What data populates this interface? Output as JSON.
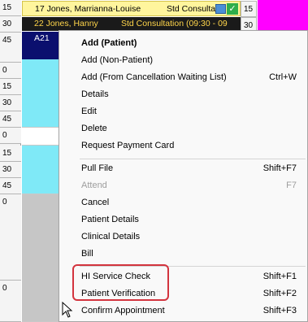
{
  "book": {
    "times_left": [
      "15",
      "30",
      "45",
      "0",
      "15",
      "30",
      "45",
      "0",
      "15",
      "30",
      "45",
      "0",
      "0"
    ],
    "time_right_1": "15",
    "time_right_2": "30",
    "appointment_1": {
      "patient": "17 Jones, Marrianna-Louise",
      "type": "Std Consulta"
    },
    "appointment_2": {
      "patient": "22 Jones, Hanny",
      "type": "Std Consultation (09:30 - 09"
    },
    "appointment_3": {
      "code": "A21"
    },
    "colors": {
      "slot_cyan": "#7fe9f7",
      "slot_grey": "#c6c6c6",
      "yellow": "#fff59d",
      "dark_blue": "#0b0f6e",
      "pink": "#ff00ff",
      "highlight_red": "#d3343e"
    }
  },
  "menu": {
    "items": [
      {
        "label": "Add (Patient)",
        "shortcut": ""
      },
      {
        "label": "Add (Non-Patient)",
        "shortcut": ""
      },
      {
        "label": "Add (From Cancellation Waiting List)",
        "shortcut": "Ctrl+W"
      },
      {
        "label": "Details",
        "shortcut": ""
      },
      {
        "label": "Edit",
        "shortcut": ""
      },
      {
        "label": "Delete",
        "shortcut": ""
      },
      {
        "label": "Request Payment Card",
        "shortcut": ""
      },
      {
        "label": "Pull File",
        "shortcut": "Shift+F7"
      },
      {
        "label": "Attend",
        "shortcut": "F7"
      },
      {
        "label": "Cancel",
        "shortcut": ""
      },
      {
        "label": "Patient Details",
        "shortcut": ""
      },
      {
        "label": "Clinical Details",
        "shortcut": ""
      },
      {
        "label": "Bill",
        "shortcut": ""
      },
      {
        "label": "HI Service Check",
        "shortcut": "Shift+F1"
      },
      {
        "label": "Patient Verification",
        "shortcut": "Shift+F2"
      },
      {
        "label": "Confirm Appointment",
        "shortcut": "Shift+F3"
      }
    ]
  }
}
